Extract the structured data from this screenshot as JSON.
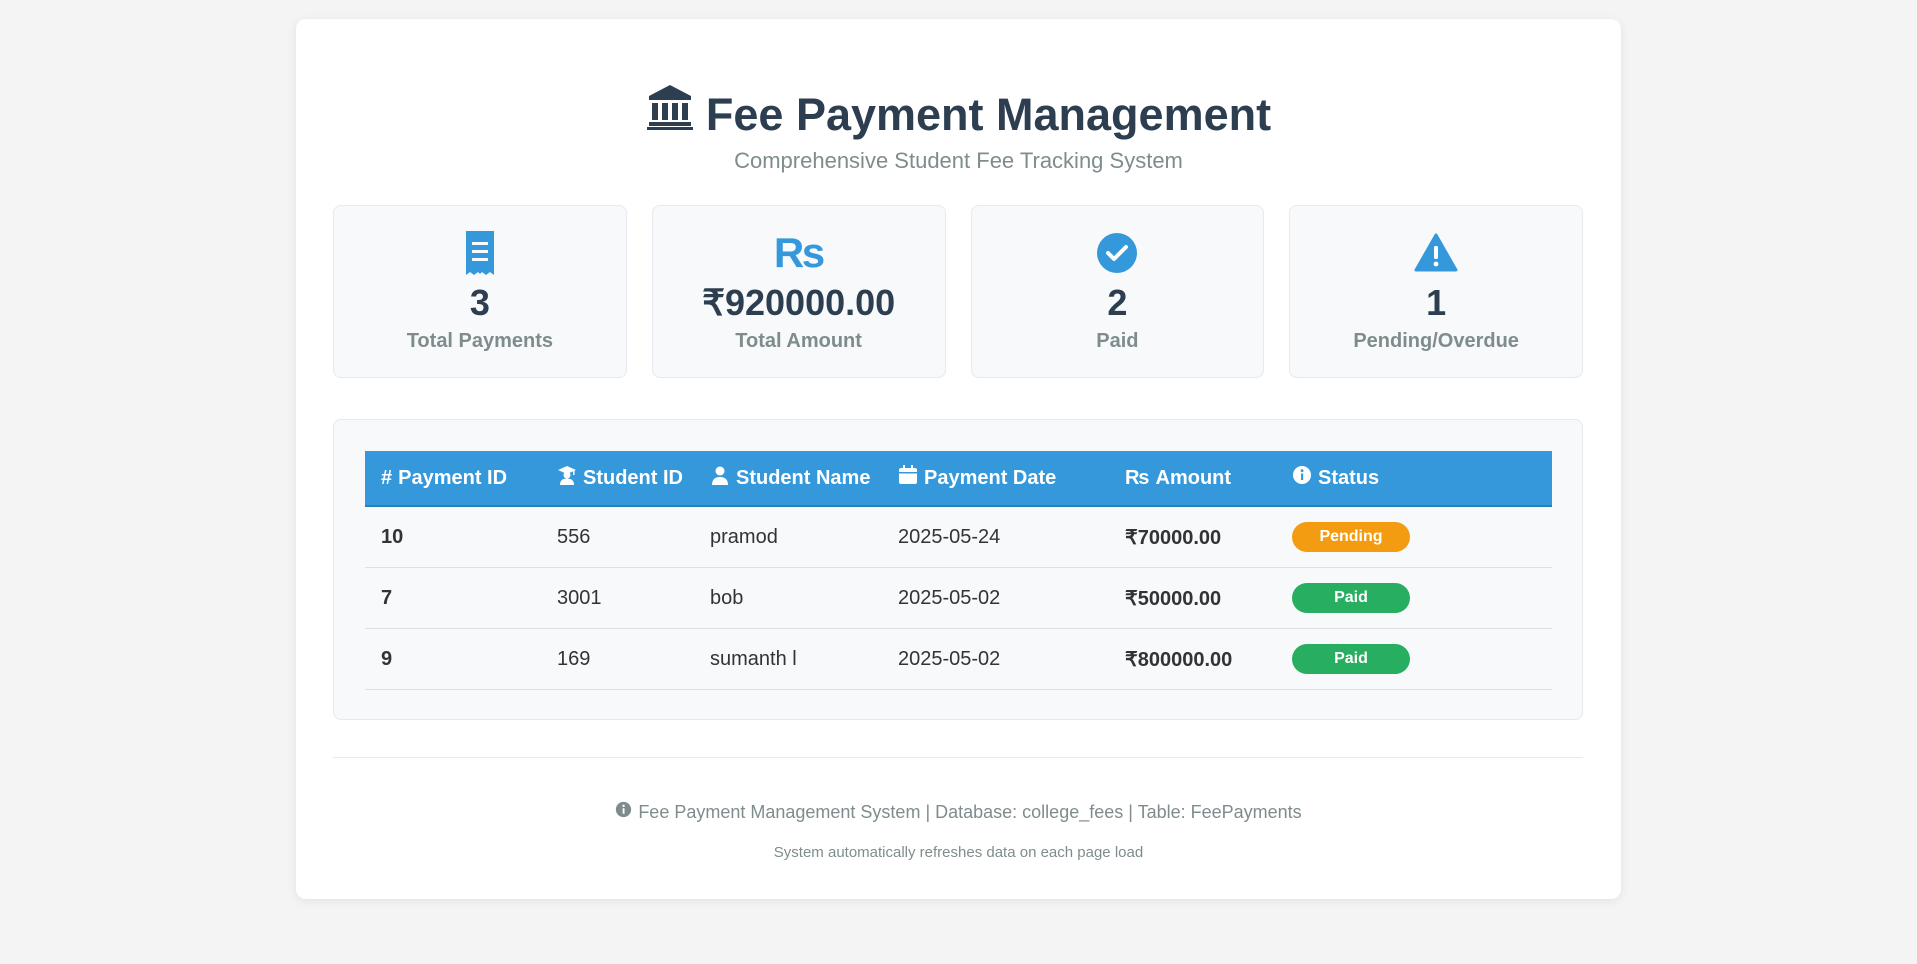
{
  "header": {
    "title": "Fee Payment Management",
    "subtitle": "Comprehensive Student Fee Tracking System",
    "icon": "bank-icon"
  },
  "stats": [
    {
      "icon": "receipt-icon",
      "value": "3",
      "label": "Total Payments"
    },
    {
      "icon": "rupee-icon",
      "icon_text": "₨",
      "value": "₹920000.00",
      "label": "Total Amount"
    },
    {
      "icon": "check-circle-icon",
      "value": "2",
      "label": "Paid"
    },
    {
      "icon": "warning-icon",
      "value": "1",
      "label": "Pending/Overdue"
    }
  ],
  "table": {
    "columns": [
      {
        "label": "Payment ID",
        "icon": "hash-icon",
        "icon_text": "#"
      },
      {
        "label": "Student ID",
        "icon": "graduate-icon"
      },
      {
        "label": "Student Name",
        "icon": "user-icon"
      },
      {
        "label": "Payment Date",
        "icon": "calendar-icon"
      },
      {
        "label": "Amount",
        "icon": "rupee-icon",
        "icon_text": "₨"
      },
      {
        "label": "Status",
        "icon": "info-icon"
      }
    ],
    "rows": [
      {
        "payment_id": "10",
        "student_id": "556",
        "student_name": "pramod",
        "payment_date": "2025-05-24",
        "amount": "₹70000.00",
        "status": "Pending"
      },
      {
        "payment_id": "7",
        "student_id": "3001",
        "student_name": "bob",
        "payment_date": "2025-05-02",
        "amount": "₹50000.00",
        "status": "Paid"
      },
      {
        "payment_id": "9",
        "student_id": "169",
        "student_name": "sumanth l",
        "payment_date": "2025-05-02",
        "amount": "₹800000.00",
        "status": "Paid"
      }
    ]
  },
  "footer": {
    "main": "Fee Payment Management System | Database: college_fees | Table: FeePayments",
    "sub": "System automatically refreshes data on each page load"
  },
  "colors": {
    "accent": "#3498db",
    "title": "#2c3e50",
    "pending": "#f39c12",
    "paid": "#27ae60"
  }
}
